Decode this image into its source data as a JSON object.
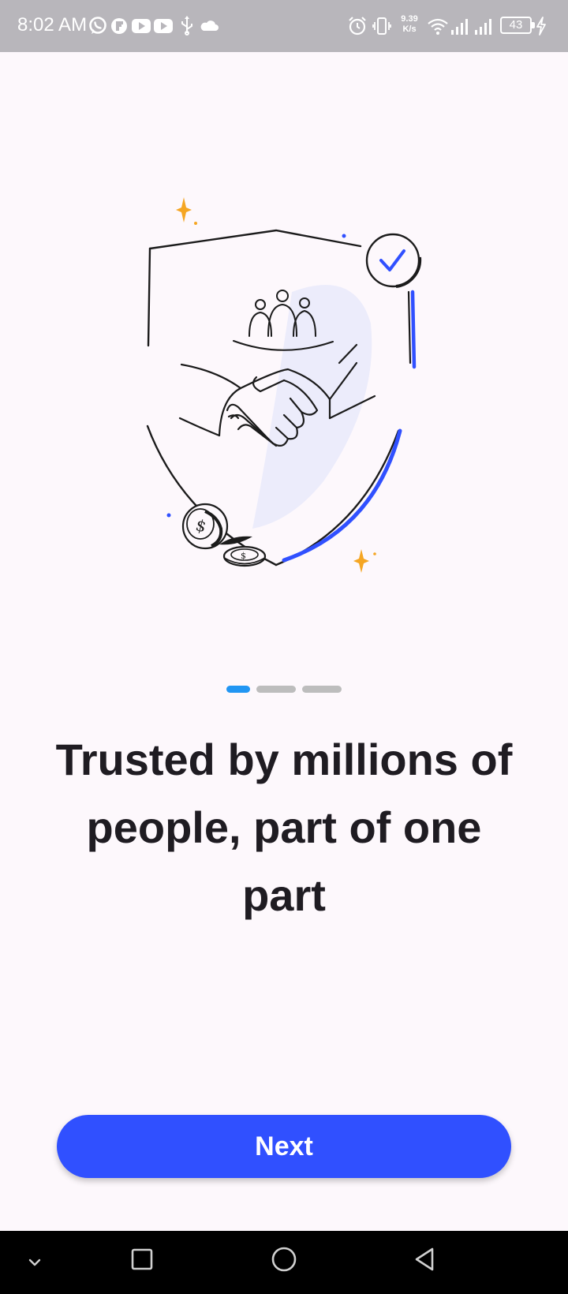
{
  "status_bar": {
    "time": "8:02 AM",
    "net_speed_value": "9.39",
    "net_speed_unit": "K/s",
    "battery": "43",
    "left_icons": [
      "whatsapp-icon",
      "flipboard-icon",
      "youtube-icon",
      "youtube-icon",
      "usb-icon",
      "cloud-icon"
    ],
    "right_icons": [
      "alarm-icon",
      "vibrate-icon",
      "wifi-icon",
      "signal-icon",
      "signal-icon",
      "battery-icon",
      "charging-icon"
    ]
  },
  "onboarding": {
    "illustration": "trust-shield-handshake-illustration",
    "pager": {
      "total": 3,
      "current": 1
    },
    "headline": "Trusted by millions of people, part of one part",
    "next_label": "Next"
  },
  "nav_bar": {
    "buttons": [
      "chevron-down-icon",
      "recents-icon",
      "home-icon",
      "back-icon"
    ]
  },
  "colors": {
    "accent": "#3050ff",
    "pager_active": "#2196f3",
    "pager_inactive": "#bdbdbd",
    "background": "#fdf8fc",
    "status_bar": "#b8b6bb"
  }
}
